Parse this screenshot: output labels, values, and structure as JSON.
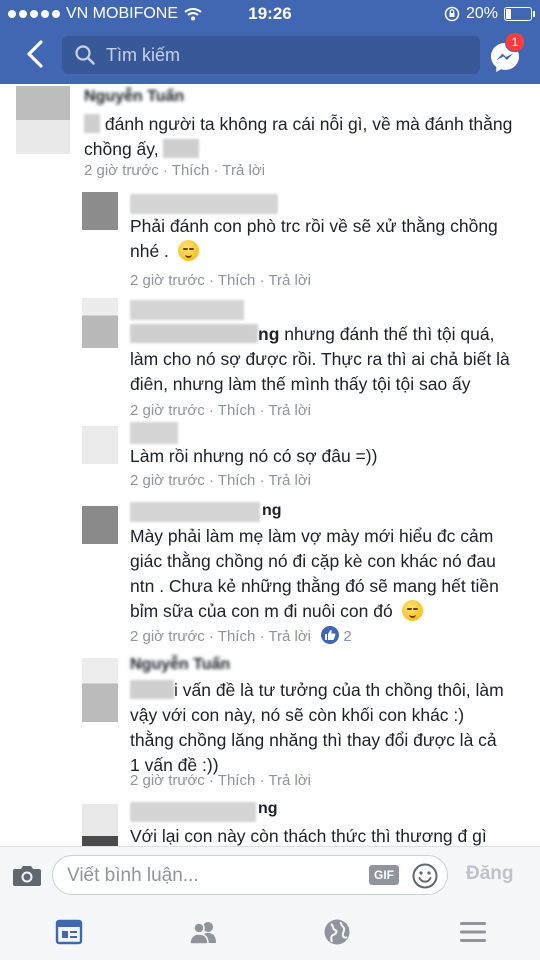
{
  "status_bar": {
    "carrier": "VN MOBIFONE",
    "time": "19:26",
    "battery": "20%"
  },
  "header": {
    "search_placeholder": "Tìm kiếm",
    "messenger_badge": "1",
    "icons": [
      "back-icon",
      "search-icon",
      "messenger-icon"
    ]
  },
  "comments": [
    {
      "level": 0,
      "name": "Nguyễn Tuấn",
      "text_a": "",
      "text_b": "đánh người ta không ra cái nỗi gì, về mà đánh thằng chồng ấy,",
      "time": "2 giờ trước",
      "like": "Thích",
      "reply": "Trả lời"
    },
    {
      "level": 1,
      "name": "",
      "text_a": "Phải đánh con phò trc rồi về sẽ xử thằng chồng nhé .",
      "emoji": "smirk",
      "time": "2 giờ trước",
      "like": "Thích",
      "reply": "Trả lời"
    },
    {
      "level": 1,
      "name": "",
      "text_a": "ng",
      "text_b": "nhưng đánh thế thì tội quá, làm cho nó sợ được rồi. Thực ra thì ai chả biết là điên, nhưng làm thế mình thấy tội tội sao ấy",
      "time": "2 giờ trước",
      "like": "Thích",
      "reply": "Trả lời"
    },
    {
      "level": 1,
      "name": "",
      "text_a": "Làm rồi nhưng nó có sợ đâu =))",
      "time": "2 giờ trước",
      "like": "Thích",
      "reply": "Trả lời"
    },
    {
      "level": 1,
      "name": "ng",
      "text_a": "Mày phải làm mẹ làm vợ mày mới hiểu đc cảm giác thằng chồng nó đi cặp kè con khác nó đau ntn . Chưa kẻ những thằng đó sẽ mang hết tiền bỉm sữa của con m đi nuôi con đó",
      "emoji": "relieved",
      "time": "2 giờ trước",
      "like": "Thích",
      "reply": "Trả lời",
      "like_count": "2"
    },
    {
      "level": 1,
      "name": "Nguyễn Tuấn",
      "text_a": "i vấn đề là tư tưởng của th chồng thôi, làm vậy với con này, nó sẽ còn khối con khác :) thằng chồng lăng nhăng thì thay đổi được là cả 1 vấn đề :))",
      "time": "2 giờ trước",
      "like": "Thích",
      "reply": "Trả lời"
    },
    {
      "level": 1,
      "name": "ng",
      "text_a": "Với lại con này còn thách thức thì thương đ gì"
    }
  ],
  "composer": {
    "placeholder": "Viết bình luận...",
    "gif_label": "GIF",
    "post_label": "Đăng"
  },
  "tabs": [
    "news-feed-icon",
    "friends-icon",
    "globe-icon",
    "menu-icon"
  ],
  "colors": {
    "brand": "#4267b2",
    "meta_text": "#90949c",
    "active_tab": "#4267b2",
    "inactive_tab": "#90949c"
  }
}
